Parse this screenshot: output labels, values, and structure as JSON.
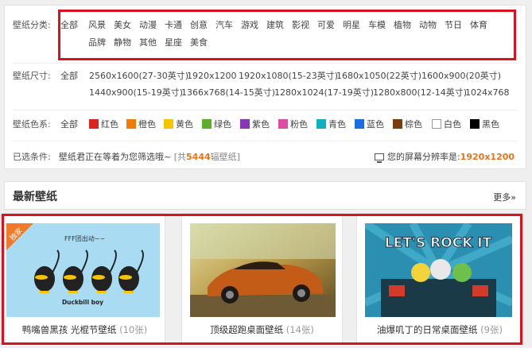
{
  "filters": {
    "category": {
      "label": "壁纸分类:",
      "options": [
        "全部",
        "风景",
        "美女",
        "动漫",
        "卡通",
        "创意",
        "汽车",
        "游戏",
        "建筑",
        "影视",
        "可爱",
        "明星",
        "车模",
        "植物",
        "动物",
        "节日",
        "体育",
        "品牌",
        "静物",
        "其他",
        "星座",
        "美食"
      ]
    },
    "size": {
      "label": "壁纸尺寸:",
      "options": [
        "全部",
        "2560x1600(27-30英寸)",
        "1920x1200",
        "1920x1080(15-23英寸)",
        "1680x1050(22英寸)",
        "1600x900(20英寸)",
        "1440x900(15-19英寸)",
        "1366x768(14-15英寸)",
        "1280x1024(17-19英寸)",
        "1280x800(12-14英寸)",
        "1024x768"
      ]
    },
    "color": {
      "label": "壁纸色系:",
      "all": "全部",
      "options": [
        {
          "name": "红色",
          "hex": "#d9251d"
        },
        {
          "name": "橙色",
          "hex": "#f07a0a"
        },
        {
          "name": "黄色",
          "hex": "#f6c400"
        },
        {
          "name": "绿色",
          "hex": "#5fad2c"
        },
        {
          "name": "紫色",
          "hex": "#8a34b8"
        },
        {
          "name": "粉色",
          "hex": "#e04ba8"
        },
        {
          "name": "青色",
          "hex": "#0fb0c0"
        },
        {
          "name": "蓝色",
          "hex": "#1a6ee0"
        },
        {
          "name": "棕色",
          "hex": "#7a3b0f"
        },
        {
          "name": "白色",
          "hex": "#ffffff"
        },
        {
          "name": "黑色",
          "hex": "#000000"
        }
      ]
    },
    "selected": {
      "label": "已选条件:",
      "message": "壁纸君正在等着为您筛选哦~",
      "count_prefix": "[共",
      "count": "5444",
      "count_suffix": "辐壁纸]",
      "resolution_label": "您的屏幕分辨率是:",
      "resolution_value": "1920x1200"
    }
  },
  "latest": {
    "title": "最新壁纸",
    "more": "更多»",
    "cards": [
      {
        "title": "鸭嘴兽黑孩 光棍节壁纸",
        "count": "(10张)",
        "badge": "独家",
        "art_text": "FFF团出动~~",
        "brand": "Duckbill boy"
      },
      {
        "title": "顶级超跑桌面壁纸",
        "count": "(14张)"
      },
      {
        "title": "油爆叽丁的日常桌面壁纸",
        "count": "(9张)",
        "art_text": "LET'S ROCK IT"
      }
    ]
  },
  "accent": "#e8741c",
  "highlight_border": "#d9121f"
}
